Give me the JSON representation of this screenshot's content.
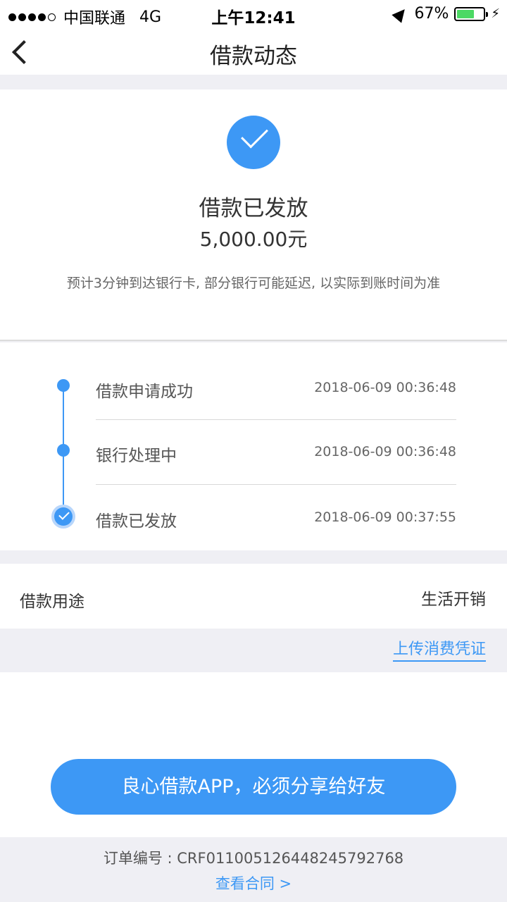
{
  "status_bar": {
    "carrier": "中国联通",
    "network": "4G",
    "time": "上午12:41",
    "battery_percent": "67%",
    "battery_level": 0.67
  },
  "nav": {
    "title": "借款动态"
  },
  "status": {
    "title": "借款已发放",
    "amount": "5,000.00元",
    "notice": "预计3分钟到达银行卡, 部分银行可能延迟, 以实际到账时间为准"
  },
  "timeline": [
    {
      "label": "借款申请成功",
      "time": "2018-06-09 00:36:48"
    },
    {
      "label": "银行处理中",
      "time": "2018-06-09 00:36:48"
    },
    {
      "label": "借款已发放",
      "time": "2018-06-09 00:37:55"
    }
  ],
  "purpose": {
    "key": "借款用途",
    "value": "生活开销"
  },
  "upload_link": "上传消费凭证",
  "share_button": "良心借款APP，必须分享给好友",
  "footer": {
    "order_no": "订单编号 : CRF0110051264482457927​68",
    "contract_link": "查看合同 >"
  },
  "colors": {
    "accent": "#3d98f5",
    "background": "#efeff4"
  }
}
